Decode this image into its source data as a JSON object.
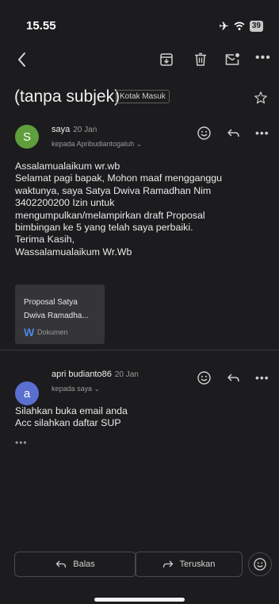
{
  "status_bar": {
    "time": "15.55",
    "battery": "39"
  },
  "toolbar": {
    "icons": [
      "back-arrow-icon",
      "archive-icon",
      "trash-icon",
      "mark-unread-icon",
      "more-icon"
    ],
    "more_label": "•••"
  },
  "thread": {
    "subject": "(tanpa subjek)",
    "label": "Kotak Masuk"
  },
  "messages": [
    {
      "avatar_letter": "S",
      "avatar_color": "#5f9e3c",
      "sender": "saya",
      "date": "20 Jan",
      "recipient": "kepada Apribudiantogaluh ⌄",
      "body_lines": [
        "Assalamualaikum wr.wb",
        "Selamat pagi bapak, Mohon maaf mengganggu",
        "waktunya, saya Satya Dwiva Ramadhan Nim",
        "3402200200 Izin untuk",
        "mengumpulkan/melampirkan draft Proposal",
        "bimbingan ke 5 yang telah saya perbaiki.",
        "Terima Kasih,",
        "Wassalamualaikum Wr.Wb"
      ],
      "attachment": {
        "name_line1": "Proposal Satya",
        "name_line2": "Dwiva Ramadha...",
        "icon_letter": "W",
        "type": "Dokumen"
      },
      "more_label": "•••"
    },
    {
      "avatar_letter": "a",
      "avatar_color": "#5b6fd0",
      "sender": "apri budianto86",
      "date": "20 Jan",
      "recipient": "kepada saya ⌄",
      "body_lines": [
        "Silahkan buka email anda",
        "Acc silahkan daftar SUP"
      ],
      "trimmed_label": "•••",
      "more_label": "•••"
    }
  ],
  "actions": {
    "reply_label": "Balas",
    "forward_label": "Teruskan"
  }
}
